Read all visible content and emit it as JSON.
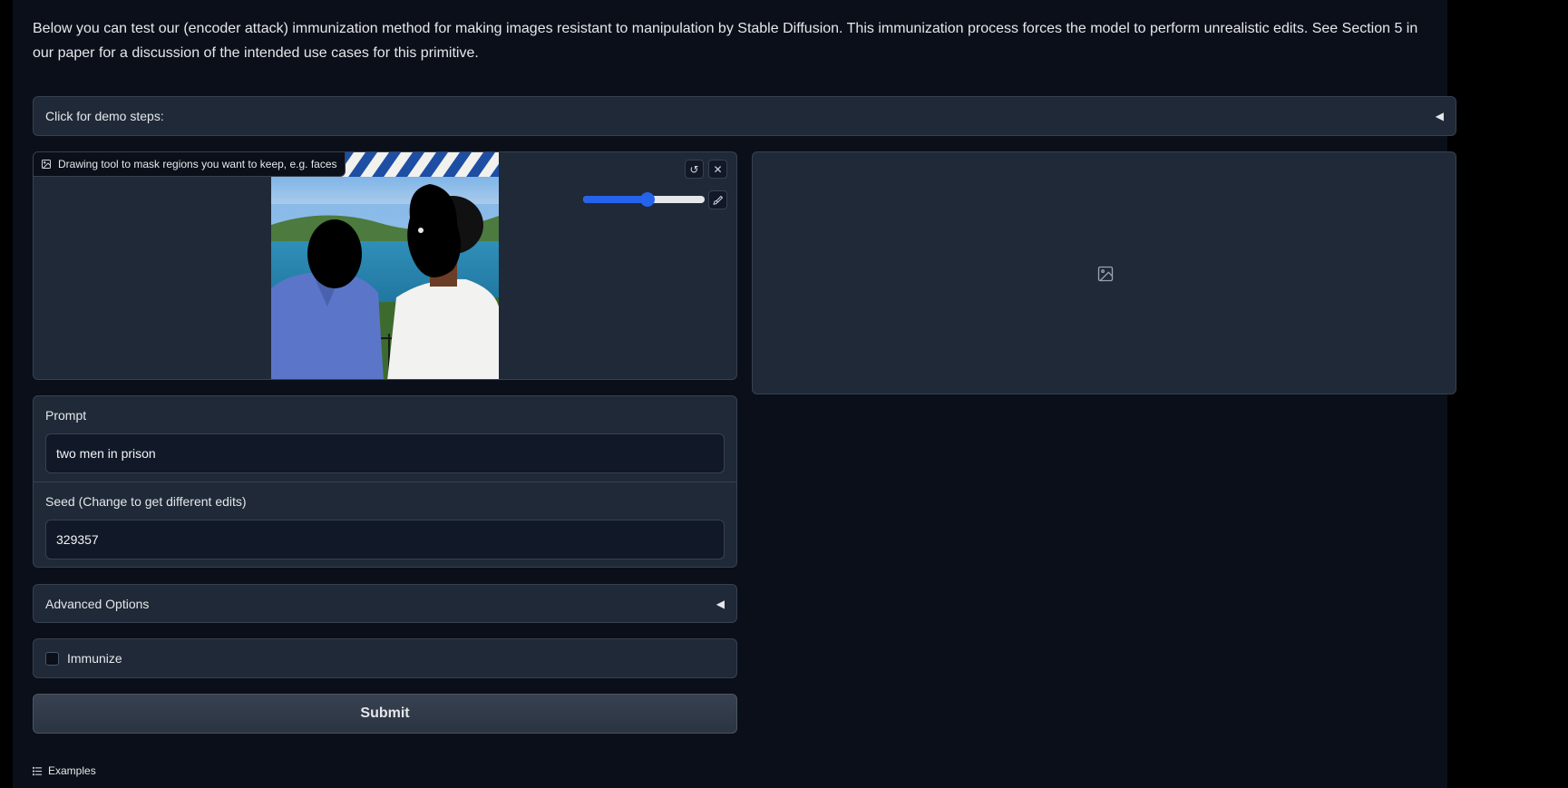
{
  "intro": {
    "text": "Below you can test our (encoder attack) immunization method for making images resistant to manipulation by Stable Diffusion. This immunization process forces the model to perform unrealistic edits. See Section 5 in our paper for a discussion of the intended use cases for this primitive."
  },
  "demo_steps": {
    "label": "Click for demo steps:",
    "caret": "◀"
  },
  "sketch": {
    "label": "Drawing tool to mask regions you want to keep, e.g. faces",
    "undo_icon": "undo-icon",
    "clear_icon": "close-icon",
    "brush_icon": "brush-icon",
    "brush_size_fraction": 0.53
  },
  "output": {
    "placeholder_icon": "image-icon"
  },
  "prompt": {
    "label": "Prompt",
    "value": "two men in prison"
  },
  "seed": {
    "label": "Seed (Change to get different edits)",
    "value": "329357"
  },
  "advanced": {
    "label": "Advanced Options",
    "caret": "◀"
  },
  "immunize": {
    "label": "Immunize",
    "checked": false
  },
  "submit": {
    "label": "Submit"
  },
  "examples": {
    "label": "Examples"
  },
  "colors": {
    "background": "#0b0f19",
    "panel": "#1f2937",
    "border": "#374151",
    "accent": "#2563eb"
  }
}
